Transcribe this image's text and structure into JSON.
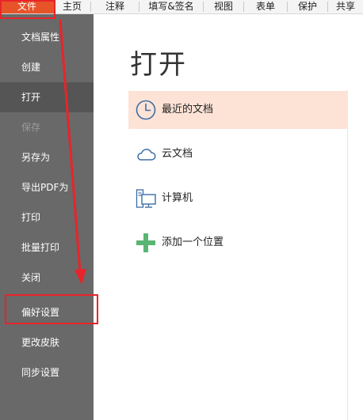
{
  "menubar": {
    "tabs": [
      {
        "label": "文件"
      },
      {
        "label": "主页"
      },
      {
        "label": "注释"
      },
      {
        "label": "填写&签名"
      },
      {
        "label": "视图"
      },
      {
        "label": "表单"
      },
      {
        "label": "保护"
      },
      {
        "label": "共享"
      }
    ],
    "active_tab": "文件"
  },
  "sidebar": {
    "items": [
      {
        "label": "文档属性"
      },
      {
        "label": "创建"
      },
      {
        "label": "打开"
      },
      {
        "label": "保存"
      },
      {
        "label": "另存为"
      },
      {
        "label": "导出PDF为"
      },
      {
        "label": "打印"
      },
      {
        "label": "批量打印"
      },
      {
        "label": "关闭"
      },
      {
        "label": "偏好设置"
      },
      {
        "label": "更改皮肤"
      },
      {
        "label": "同步设置"
      }
    ],
    "selected": "打开",
    "disabled": [
      "保存"
    ]
  },
  "main": {
    "title": "打开",
    "locations": [
      {
        "label": "最近的文档",
        "icon": "clock-icon"
      },
      {
        "label": "云文档",
        "icon": "cloud-icon"
      },
      {
        "label": "计算机",
        "icon": "computer-icon"
      },
      {
        "label": "添加一个位置",
        "icon": "plus-icon"
      }
    ]
  },
  "colors": {
    "accent": "#e8542a",
    "sidebar_bg": "#696969",
    "sidebar_selected": "#555555",
    "highlight_row": "#fde3d6",
    "annotation_red": "#e8242a",
    "icon_blue": "#3c6ea5",
    "icon_green": "#5ab473"
  }
}
